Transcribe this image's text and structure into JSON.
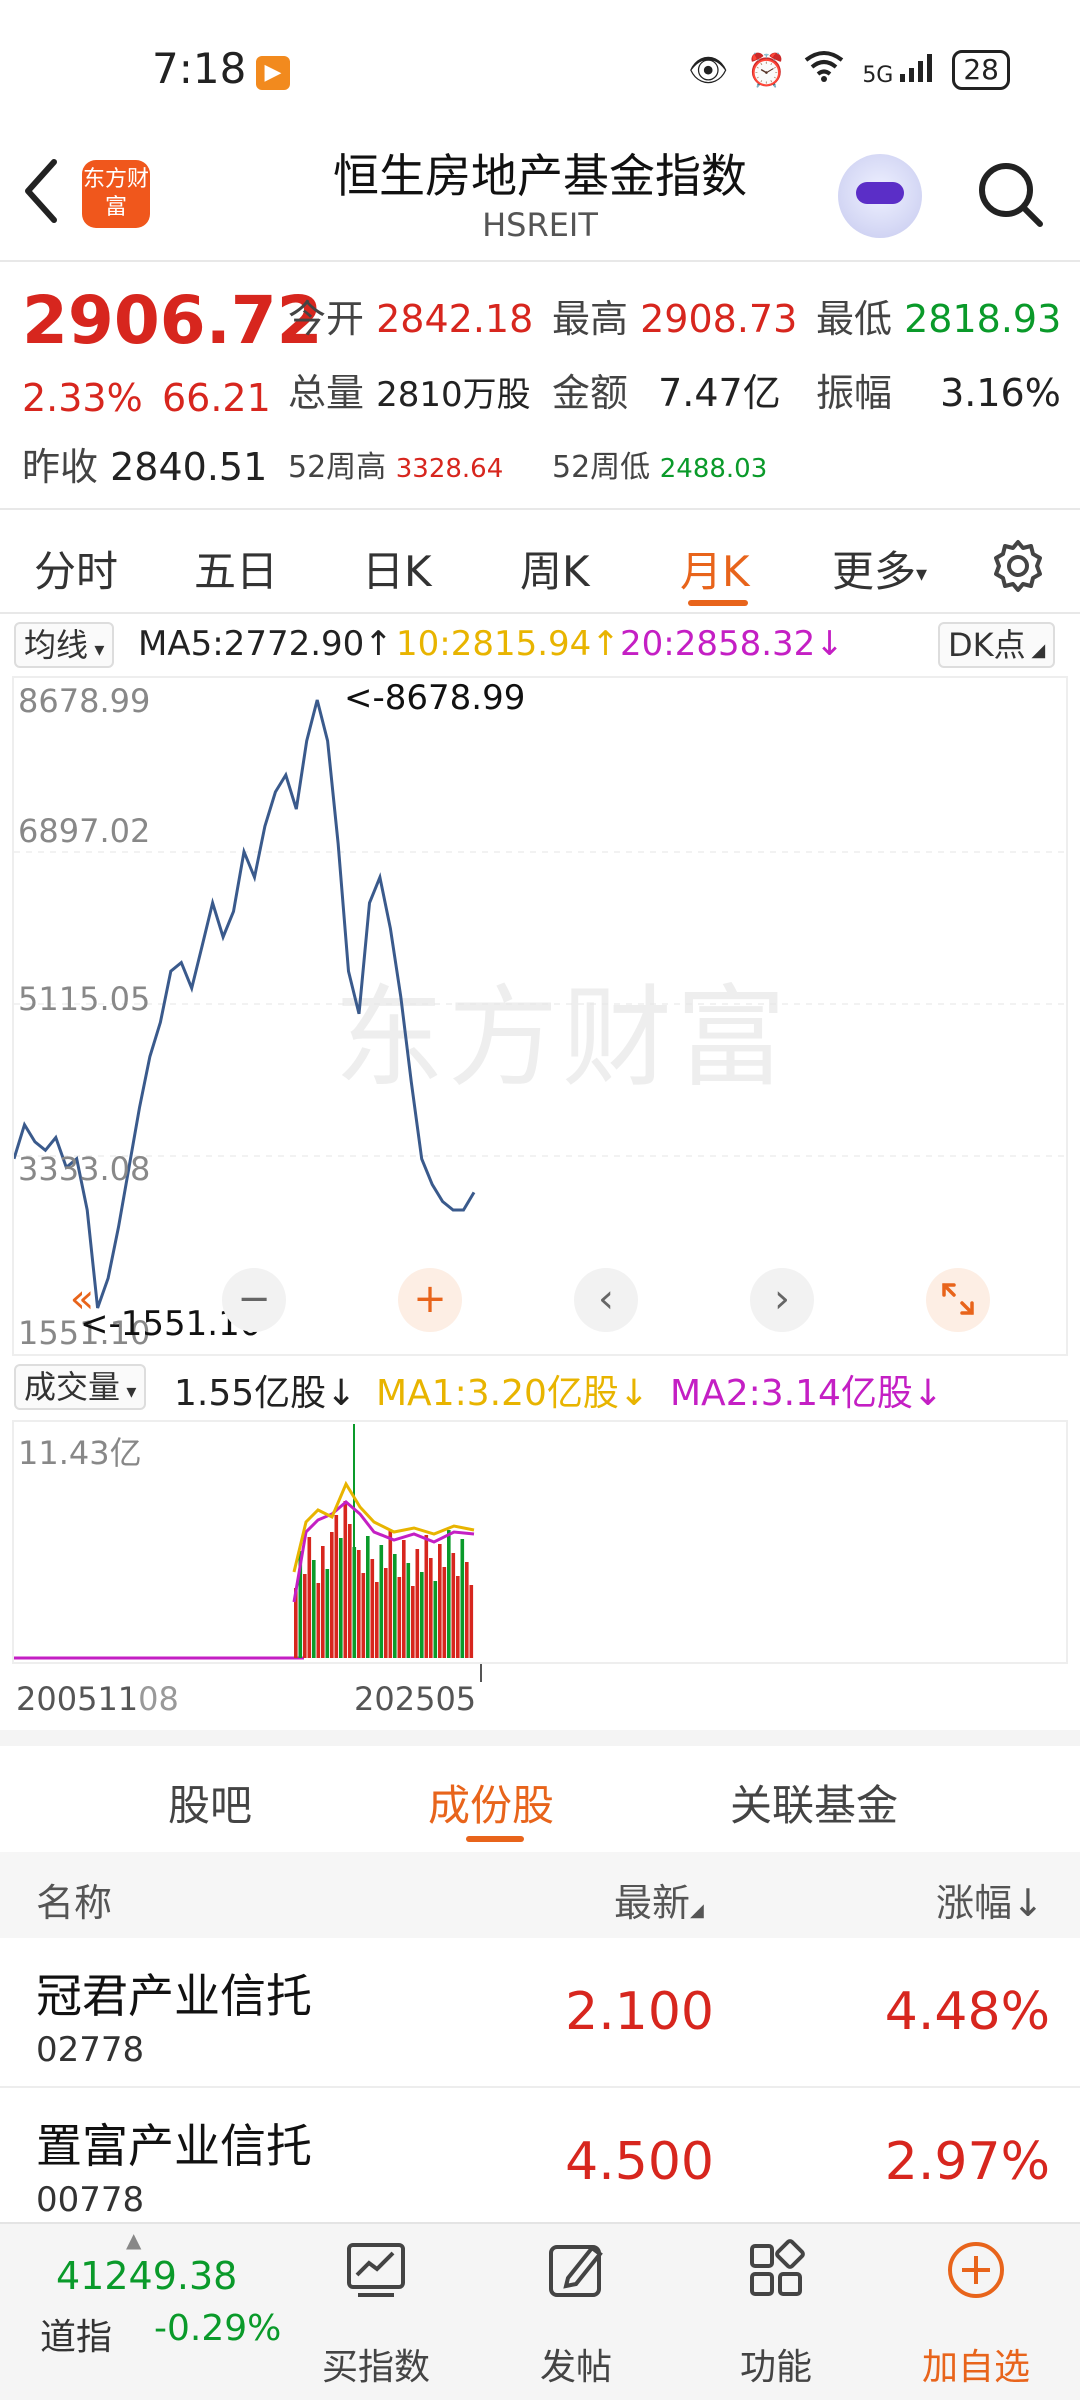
{
  "status": {
    "time": "7:18",
    "battery": "28",
    "network": "5G"
  },
  "header": {
    "title": "恒生房地产基金指数",
    "subtitle": "HSREIT",
    "logo_text": "东方财富"
  },
  "quote": {
    "price": "2906.72",
    "change_pct": "2.33%",
    "change_abs": "66.21",
    "open_label": "今开",
    "open": "2842.18",
    "high_label": "最高",
    "high": "2908.73",
    "low_label": "最低",
    "low": "2818.93",
    "volume_label": "总量",
    "volume": "2810万股",
    "amount_label": "金额",
    "amount": "7.47亿",
    "amplitude_label": "振幅",
    "amplitude": "3.16%",
    "prev_close_label": "昨收",
    "prev_close": "2840.51",
    "w52_high_label": "52周高",
    "w52_high": "3328.64",
    "w52_low_label": "52周低",
    "w52_low": "2488.03"
  },
  "period_tabs": [
    "分时",
    "五日",
    "日K",
    "周K",
    "月K",
    "更多"
  ],
  "active_period": "月K",
  "ma": {
    "selector": "均线",
    "ma5": "MA5:2772.90↑",
    "ma10": "10:2815.94↑",
    "ma20": "20:2858.32↓",
    "dk": "DK点"
  },
  "chart": {
    "y_labels": [
      "8678.99",
      "6897.02",
      "5115.05",
      "3333.08",
      "1551.10"
    ],
    "max_marker": "<-8678.99",
    "min_marker": "<-1551.10",
    "watermark": "东方财富",
    "zoom_minus": "−",
    "zoom_plus": "+",
    "colors": {
      "line": "#3a5a8c",
      "up": "#d7261e",
      "accent": "#e8641b"
    }
  },
  "chart_data": {
    "type": "line",
    "title": "",
    "ylim": [
      1551.1,
      8678.99
    ],
    "y_ticks": [
      8678.99,
      6897.02,
      5115.05,
      3333.08,
      1551.1
    ],
    "x_labels": [
      "200511",
      "202505"
    ],
    "series": [
      {
        "values": [
          3300,
          3700,
          3500,
          3400,
          3550,
          3200,
          3300,
          2700,
          1551.1,
          1900,
          2500,
          3200,
          3900,
          4500,
          4900,
          5500,
          5600,
          5300,
          5800,
          6300,
          5900,
          6200,
          6900,
          6600,
          7200,
          7600,
          7800,
          7400,
          8200,
          8678.99,
          8200,
          7000,
          5500,
          5000,
          6300,
          6600,
          6000,
          5200,
          4200,
          3300,
          3000,
          2800,
          2700,
          2700,
          2906.72
        ]
      }
    ],
    "volume": {
      "label": "成交量",
      "current": "1.55亿股↓",
      "ma1": "MA1:3.20亿股↓",
      "ma2": "MA2:3.14亿股↓",
      "max_label": "11.43亿"
    }
  },
  "x_labels": {
    "start": "200511",
    "start_suffix": "08",
    "end": "202505"
  },
  "sub_tabs": [
    "股吧",
    "成份股",
    "关联基金"
  ],
  "active_sub_tab": "成份股",
  "list": {
    "col_name": "名称",
    "col_price": "最新",
    "col_change": "涨幅↓",
    "rows": [
      {
        "name": "冠君产业信托",
        "code": "02778",
        "price": "2.100",
        "change": "4.48%"
      },
      {
        "name": "置富产业信托",
        "code": "00778",
        "price": "4.500",
        "change": "2.97%"
      }
    ]
  },
  "bottom": {
    "index_value": "41249.38",
    "index_name": "道指",
    "index_change": "-0.29%",
    "nav": [
      "买指数",
      "发帖",
      "功能",
      "加自选"
    ]
  }
}
